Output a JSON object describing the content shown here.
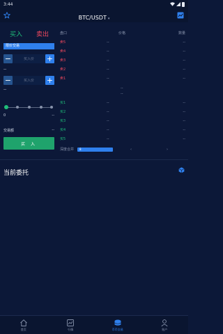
{
  "status_bar": {
    "time": "3:44"
  },
  "header": {
    "pair": "BTC/USDT",
    "caret": "▾"
  },
  "trade_tabs": {
    "buy": "买入",
    "sell": "卖出"
  },
  "order_type": "限价交易",
  "price_input": {
    "placeholder": "买入价",
    "minus": "−",
    "plus": "+"
  },
  "amount_input": {
    "placeholder": "买入价",
    "minus": "−",
    "plus": "+"
  },
  "dash_1": "--",
  "slider": {
    "percent": 0
  },
  "amount_row": {
    "left": "0",
    "right": "--"
  },
  "volume_row": {
    "label": "交易额",
    "value": "--"
  },
  "buy_button": "买 入",
  "order_book": {
    "headers": {
      "market": "盘口",
      "price": "价格",
      "qty": "数量"
    },
    "asks": [
      {
        "label": "卖5",
        "price": "--",
        "qty": "--"
      },
      {
        "label": "卖4",
        "price": "--",
        "qty": "--"
      },
      {
        "label": "卖3",
        "price": "--",
        "qty": "--"
      },
      {
        "label": "卖2",
        "price": "--",
        "qty": "--"
      },
      {
        "label": "卖1",
        "price": "--",
        "qty": "--"
      }
    ],
    "mid": [
      "--",
      "--"
    ],
    "bids": [
      {
        "label": "买1",
        "price": "--",
        "qty": "--"
      },
      {
        "label": "买2",
        "price": "--",
        "qty": "--"
      },
      {
        "label": "买3",
        "price": "--",
        "qty": "--"
      },
      {
        "label": "买4",
        "price": "--",
        "qty": "--"
      },
      {
        "label": "买5",
        "price": "--",
        "qty": "--"
      }
    ],
    "depth": {
      "label": "深度合并",
      "value": "8",
      "left_arrow": "‹",
      "right_arrow": "›"
    }
  },
  "current_orders_title": "当前委托",
  "bottom_nav": [
    {
      "label": "首页",
      "icon": "home-icon"
    },
    {
      "label": "行情",
      "icon": "market-chart-icon"
    },
    {
      "label": "币币交易",
      "icon": "coin-trade-icon"
    },
    {
      "label": "账户",
      "icon": "account-icon"
    }
  ],
  "colors": {
    "buy": "#1fbf7a",
    "sell": "#f0485e",
    "accent": "#2f80ed",
    "background": "#0c1838"
  }
}
